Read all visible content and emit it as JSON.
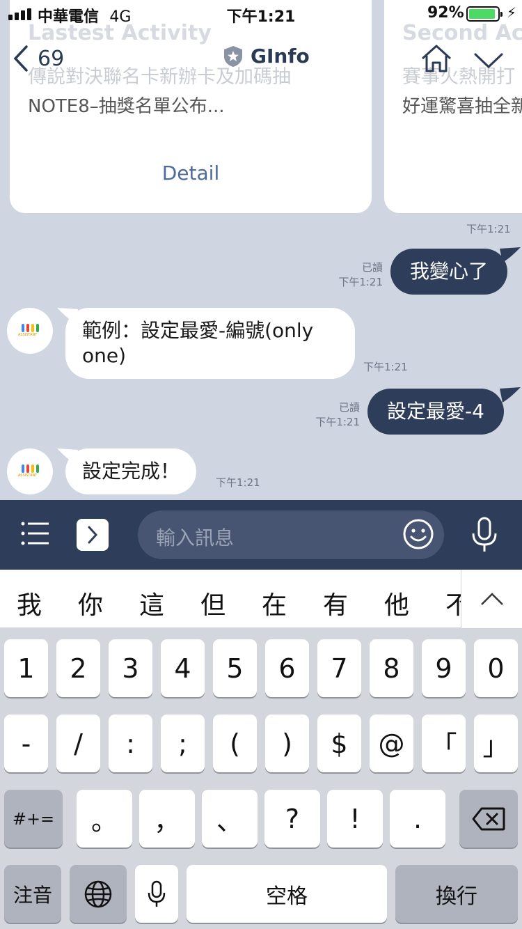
{
  "status_bar": {
    "carrier": "中華電信",
    "network": "4G",
    "time": "下午1:21",
    "battery_percent": "92%",
    "battery_level": 0.92
  },
  "nav": {
    "back_count": "69",
    "title": "GInfo"
  },
  "cards": [
    {
      "title": "Lastest Activity",
      "subtitle": "傳說對決聯名卡新辦卡及加碼抽",
      "description": "NOTE8–抽獎名單公布...",
      "detail_label": "Detail"
    },
    {
      "title": "Second Act",
      "subtitle": "賽事火熱開打",
      "description": "好運驚喜抽全新"
    }
  ],
  "cards_time": "下午1:21",
  "messages": [
    {
      "direction": "out",
      "text": "我變心了",
      "read": "已讀",
      "time": "下午1:21"
    },
    {
      "direction": "in",
      "text": "範例：設定最愛-編號(only one)",
      "time": "下午1:21"
    },
    {
      "direction": "out",
      "text": "設定最愛-4",
      "read": "已讀",
      "time": "下午1:21"
    },
    {
      "direction": "in",
      "text": "設定完成！",
      "time": "下午1:21"
    }
  ],
  "avatar_label": "ASSISTANT",
  "input": {
    "placeholder": "輸入訊息"
  },
  "candidates": [
    "我",
    "你",
    "這",
    "但",
    "在",
    "有",
    "他",
    "不"
  ],
  "keyboard": {
    "row1": [
      "1",
      "2",
      "3",
      "4",
      "5",
      "6",
      "7",
      "8",
      "9",
      "0"
    ],
    "row2": [
      "-",
      "/",
      ":",
      ";",
      "(",
      ")",
      "$",
      "@",
      "「",
      "」"
    ],
    "row3": [
      "#+=",
      "。",
      "，",
      "、",
      "?",
      "!",
      "."
    ],
    "row4": {
      "mode": "注音",
      "space": "空格",
      "return": "換行"
    }
  },
  "colors": {
    "chat_bg": "#cfd6e1",
    "bubble_out": "#2e3d59",
    "bubble_in": "#ffffff",
    "input_bar": "#2e3d59",
    "link": "#4c6a9b",
    "battery": "#4cd964"
  }
}
